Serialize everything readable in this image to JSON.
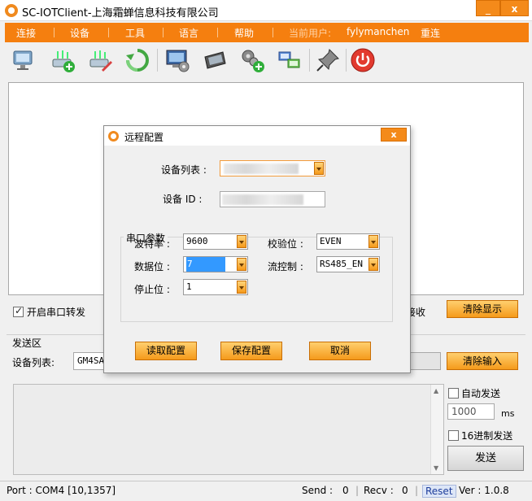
{
  "window": {
    "title": "SC-IOTClient-上海霜蝉信息科技有限公司",
    "min_glyph": "_",
    "close_glyph": "x"
  },
  "menu": {
    "items": [
      "连接",
      "设备",
      "工具",
      "语言",
      "帮助"
    ],
    "current_user_label": "当前用户:",
    "username": "fylymanchen",
    "reconnect": "重连"
  },
  "toolbar": {
    "icons": [
      "monitor-network-icon",
      "router-add-icon",
      "router-edit-icon",
      "refresh-icon",
      "computer-settings-icon",
      "tablet-device-icon",
      "gears-add-icon",
      "windows-connect-icon",
      "pin-icon",
      "power-icon"
    ]
  },
  "receive": {
    "serial_forward_label": "开启串口转发",
    "partial_label": "接收",
    "clear_display_button": "清除显示"
  },
  "send": {
    "section_label": "发送区",
    "device_list_label": "设备列表:",
    "device_value": "GM4SA",
    "clear_input_button": "清除输入",
    "auto_send_label": "自动发送",
    "interval_value": "1000",
    "interval_unit": "ms",
    "hex_send_label": "16进制发送",
    "send_button": "发送"
  },
  "status": {
    "port": "Port : COM4 [10,1357]",
    "send_label": "Send :",
    "send_value": "0",
    "recv_label": "Recv :",
    "recv_value": "0",
    "reset": "Reset",
    "version": "Ver :  1.0.8"
  },
  "dialog": {
    "title": "远程配置",
    "close_glyph": "x",
    "device_list_label": "设备列表 :",
    "device_id_label": "设备 ID :",
    "serial_group_label": "串口参数",
    "baud_label": "波特率 :",
    "baud_value": "9600",
    "data_bits_label": "数据位 :",
    "data_bits_value": "7",
    "stop_bits_label": "停止位 :",
    "stop_bits_value": "1",
    "parity_label": "校验位 :",
    "parity_value": "EVEN",
    "flow_label": "流控制 :",
    "flow_value": "RS485_EN",
    "read_button": "读取配置",
    "save_button": "保存配置",
    "cancel_button": "取消"
  }
}
